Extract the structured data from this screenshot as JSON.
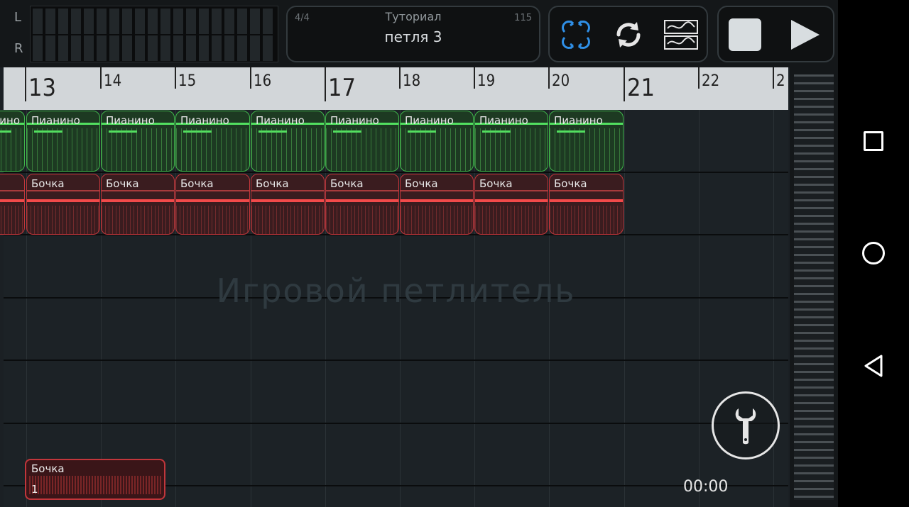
{
  "meter": {
    "left_label": "L",
    "right_label": "R"
  },
  "project": {
    "time_signature": "4/4",
    "tempo": "115",
    "title": "Туториал",
    "loop": "петля 3"
  },
  "toolbar": {
    "loop_mode_icon": "loop-grid-icon",
    "repeat_icon": "repeat-icon",
    "waveform_icon": "waveform-icon",
    "stop_icon": "stop-icon",
    "play_icon": "play-icon"
  },
  "ruler": {
    "marks": [
      {
        "label": "13",
        "major": true
      },
      {
        "label": "14",
        "major": false
      },
      {
        "label": "15",
        "major": false
      },
      {
        "label": "16",
        "major": false
      },
      {
        "label": "17",
        "major": true
      },
      {
        "label": "18",
        "major": false
      },
      {
        "label": "19",
        "major": false
      },
      {
        "label": "20",
        "major": false
      },
      {
        "label": "21",
        "major": true
      },
      {
        "label": "22",
        "major": false
      },
      {
        "label": "2",
        "major": false
      }
    ]
  },
  "tracks": [
    {
      "name": "Пианино",
      "color": "#3fb64a",
      "clip_count": 9
    },
    {
      "name": "Бочка",
      "color": "#c2363b",
      "clip_count": 9
    }
  ],
  "watermark": "Игровой петлитель",
  "sample": {
    "name": "Бочка",
    "number": "1",
    "color": "#c2363b"
  },
  "wrench_icon": "wrench-icon",
  "clock": "00:00",
  "nav": {
    "recents_icon": "recents-square-icon",
    "home_icon": "home-circle-icon",
    "back_icon": "back-triangle-icon"
  }
}
